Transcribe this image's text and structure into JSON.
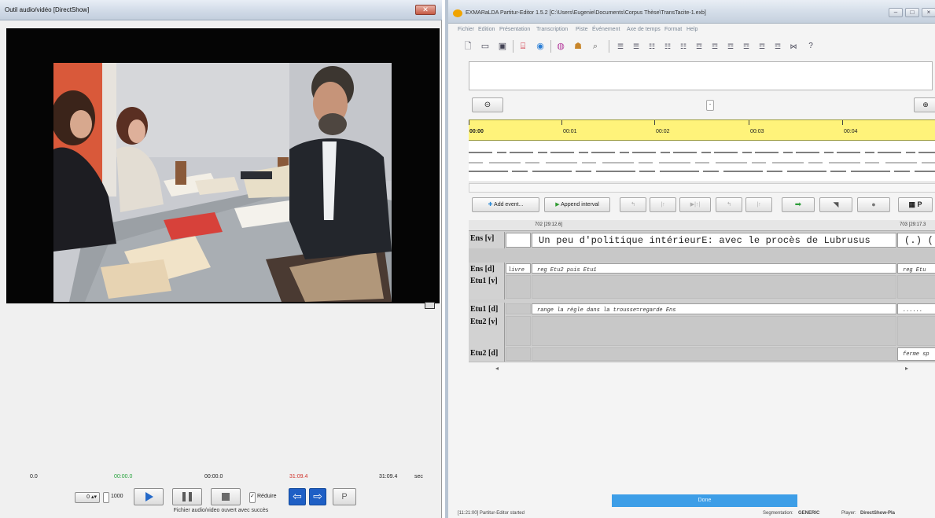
{
  "left_window": {
    "title": "Outil audio/vidéo [DirectShow]",
    "close_glyph": "✕",
    "times": {
      "start": "0.0",
      "current_green": "00:00.0",
      "current": "00:00.0",
      "total_red": "31:09.4",
      "total": "31:09.4",
      "unit": "sec"
    },
    "loop_value": "0",
    "loop_label": "1000",
    "reduce_label": "Réduire",
    "p_label": "P",
    "status": "Fichier audio/video ouvert avec succès"
  },
  "right_window": {
    "title": "EXMARaLDA Partitur-Editor 1.5.2 [C:\\Users\\Eugenie\\Documents\\Corpus Thèse\\TransTacite-1.exb]",
    "menu": [
      "Fichier",
      "Edition",
      "Présentation",
      "Transcription",
      "Piste",
      "Événement",
      "Axe de temps",
      "Format",
      "Help"
    ],
    "icons": [
      "new-file-icon",
      "open-folder-icon",
      "save-icon",
      "presentation-icon",
      "audio-player-icon",
      "speaker-icon",
      "users-icon",
      "search-icon"
    ],
    "timeline_labels": [
      "00:00",
      "00:01",
      "00:02",
      "00:03",
      "00:04"
    ],
    "page_field": "-",
    "buttons": {
      "add_event": "Add event...",
      "append_interval": "Append interval",
      "p_label": "P"
    },
    "grid": {
      "head_left": "702 [29:12.6]",
      "head_right": "703 [29:17.3",
      "rows": [
        {
          "label": "Ens [v]",
          "left": "",
          "main": "Un peu d'politique intérieurE: avec le procès de Lubrusus",
          "right": "(.) (",
          "kind": "v"
        },
        {
          "label": "Ens [d]",
          "left": "livre",
          "main": "reg Etu2 puis Etu1",
          "right": "reg Etu",
          "kind": "d"
        },
        {
          "label": "Etu1 [v]",
          "left": "",
          "main": "",
          "right": "",
          "kind": "v"
        },
        {
          "label": "Etu1 [d]",
          "left": "",
          "main": "range la règle dans la trousse=regarde Ens",
          "right": "......",
          "kind": "d"
        },
        {
          "label": "Etu2 [v]",
          "left": "",
          "main": "",
          "right": "",
          "kind": "v"
        },
        {
          "label": "Etu2 [d]",
          "left": "",
          "main": "",
          "right": "ferme sp",
          "kind": "d"
        }
      ]
    },
    "progress_text": "Done",
    "status": {
      "left": "[11:21:00] Partitur-Editor started",
      "segmentation_label": "Segmentation:",
      "segmentation_value": "GENERIC",
      "player_label": "Player:",
      "player_value": "DirectShow-Pla"
    }
  }
}
